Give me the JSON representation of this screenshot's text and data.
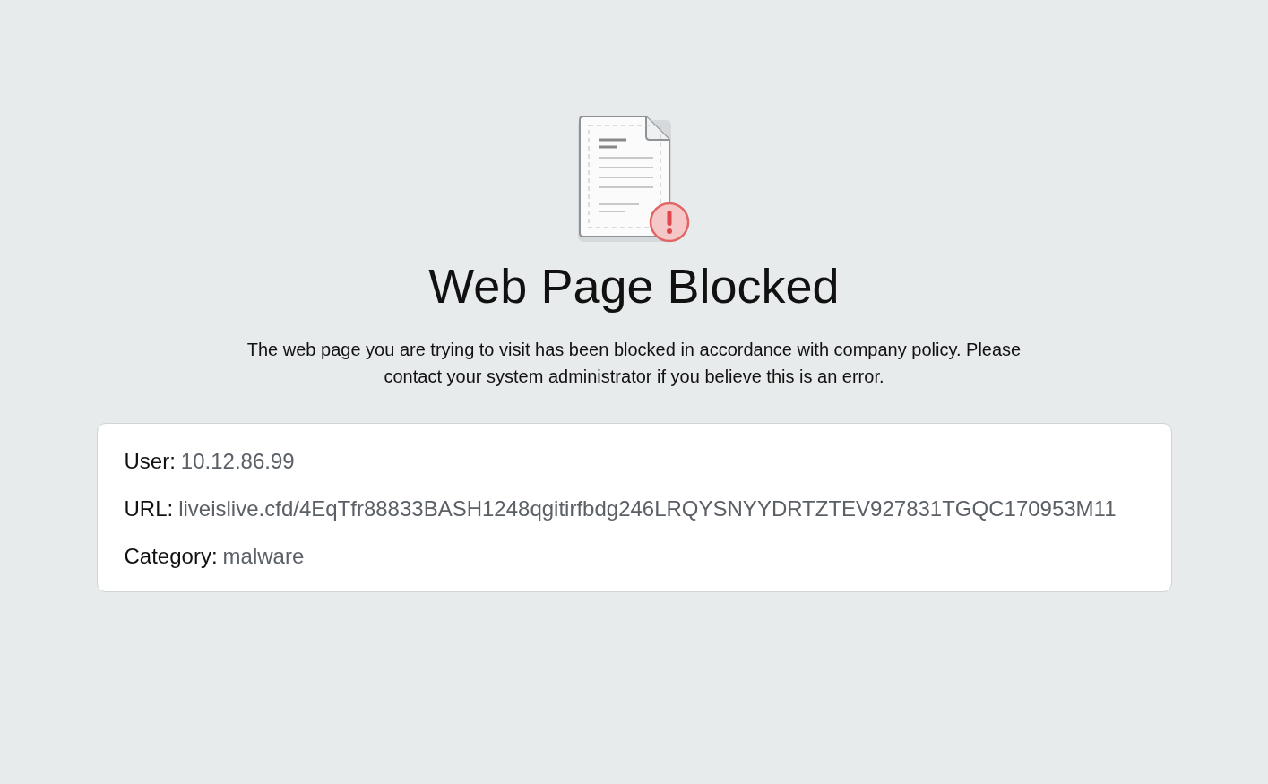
{
  "title": "Web Page Blocked",
  "message": "The web page you are trying to visit has been blocked in accordance with company policy. Please contact your system administrator if you believe this is an error.",
  "details": [
    {
      "label": "User:",
      "value": "10.12.86.99"
    },
    {
      "label": "URL:",
      "value": "liveislive.cfd/4EqTfr88833BASH1248qgitirfbdg246LRQYSNYYDRTZTEV927831TGQC170953M11"
    },
    {
      "label": "Category:",
      "value": "malware"
    }
  ]
}
